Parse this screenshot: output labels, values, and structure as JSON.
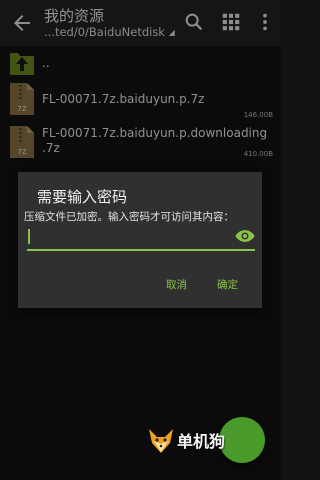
{
  "appbar": {
    "title": "我的资源",
    "path": "...ted/0/BaiduNetdisk",
    "icons": [
      "back-arrow-icon",
      "search-icon",
      "grid-view-icon",
      "more-vert-icon"
    ]
  },
  "files": [
    {
      "name": "..",
      "size": "",
      "icon": "folder-up-icon"
    },
    {
      "name": "FL-00071.7z.baiduyun.p.7z",
      "size": "146.00B",
      "badge": "7Z",
      "icon": "archive-icon"
    },
    {
      "name": "FL-00071.7z.baiduyun.p.downloading",
      "name_line2": ".7z",
      "size": "410.00B",
      "badge": "7Z",
      "icon": "archive-icon"
    }
  ],
  "dialog": {
    "title": "需要输入密码",
    "message": "压缩文件已加密。输入密码才可访问其内容：",
    "password_value": "",
    "cancel_label": "取消",
    "ok_label": "确定"
  },
  "watermark": {
    "text": "单机狗"
  },
  "colors": {
    "accent": "#8bc34a",
    "fab": "#4a9a2c",
    "appbar": "#232323",
    "dialog": "#303030"
  }
}
